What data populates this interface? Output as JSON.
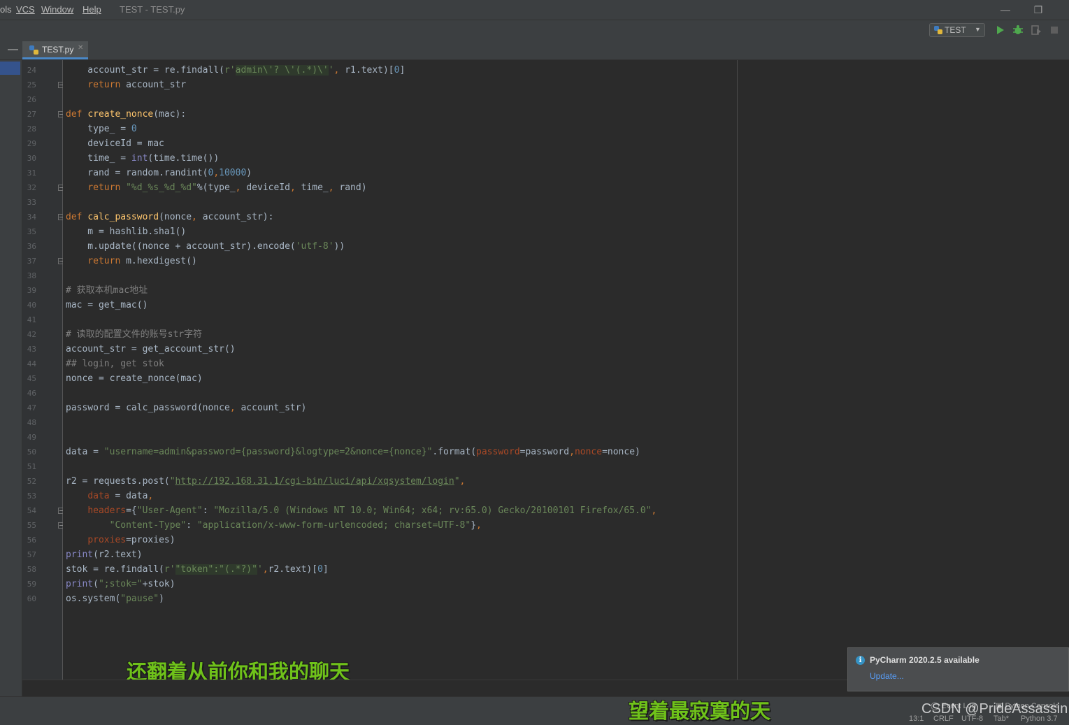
{
  "menu": {
    "items": [
      {
        "label": "ols"
      },
      {
        "label": "VCS"
      },
      {
        "label": "Window"
      },
      {
        "label": "Help"
      }
    ]
  },
  "window": {
    "title": "TEST - TEST.py"
  },
  "toolbar": {
    "run_config": "TEST"
  },
  "tabs": [
    {
      "label": "TEST.py"
    }
  ],
  "editor": {
    "lines": [
      {
        "n": "24",
        "fold": false,
        "html": "    account_str = re.findall(<span class=\"str\">r'</span><span class=\"regex\">admin\\'? \\'(.*)\\'</span><span class=\"str\">'</span><span class=\"kw\">, </span>r1.text)[<span class=\"num\">0</span>]"
      },
      {
        "n": "25",
        "fold": true,
        "html": "    <span class=\"kw\">return</span> account_str"
      },
      {
        "n": "26",
        "fold": false,
        "html": ""
      },
      {
        "n": "27",
        "fold": true,
        "html": "<span class=\"kw\">def</span> <span class=\"fn\">create_nonce</span>(mac):"
      },
      {
        "n": "28",
        "fold": false,
        "html": "    type_ = <span class=\"num\">0</span>"
      },
      {
        "n": "29",
        "fold": false,
        "html": "    deviceId = mac"
      },
      {
        "n": "30",
        "fold": false,
        "html": "    time_ = <span class=\"bi\">int</span>(time.time())"
      },
      {
        "n": "31",
        "fold": false,
        "html": "    rand = random.randint(<span class=\"num\">0</span><span class=\"kw\">,</span><span class=\"num\">10000</span>)"
      },
      {
        "n": "32",
        "fold": true,
        "html": "    <span class=\"kw\">return</span> <span class=\"str\">\"%d_%s_%d_%d\"</span>%(type_<span class=\"kw\">, </span>deviceId<span class=\"kw\">, </span>time_<span class=\"kw\">, </span>rand)"
      },
      {
        "n": "33",
        "fold": false,
        "html": ""
      },
      {
        "n": "34",
        "fold": true,
        "html": "<span class=\"kw\">def</span> <span class=\"fn\">calc_password</span>(nonce<span class=\"kw\">, </span>account_str):"
      },
      {
        "n": "35",
        "fold": false,
        "html": "    m = hashlib.sha1()"
      },
      {
        "n": "36",
        "fold": false,
        "html": "    m.update((nonce + account_str).encode(<span class=\"str\">'utf-8'</span>))"
      },
      {
        "n": "37",
        "fold": true,
        "html": "    <span class=\"kw\">return</span> m.hexdigest()"
      },
      {
        "n": "38",
        "fold": false,
        "html": ""
      },
      {
        "n": "39",
        "fold": false,
        "html": "<span class=\"cmt\"># 获取本机mac地址</span>"
      },
      {
        "n": "40",
        "fold": false,
        "html": "mac = get_mac()"
      },
      {
        "n": "41",
        "fold": false,
        "html": ""
      },
      {
        "n": "42",
        "fold": false,
        "html": "<span class=\"cmt\"># 读取的配置文件的账号str字符</span>"
      },
      {
        "n": "43",
        "fold": false,
        "html": "account_str = get_account_str()"
      },
      {
        "n": "44",
        "fold": false,
        "html": "<span class=\"cmt\">## login, get stok</span>"
      },
      {
        "n": "45",
        "fold": false,
        "html": "nonce = create_nonce(mac)"
      },
      {
        "n": "46",
        "fold": false,
        "html": ""
      },
      {
        "n": "47",
        "fold": false,
        "html": "password = calc_password(nonce<span class=\"kw\">, </span>account_str)"
      },
      {
        "n": "48",
        "fold": false,
        "html": ""
      },
      {
        "n": "49",
        "fold": false,
        "html": ""
      },
      {
        "n": "50",
        "fold": false,
        "html": "data = <span class=\"str\">\"username=admin&amp;password={password}&amp;logtype=2&amp;nonce={nonce}\"</span>.format(<span class=\"kwarg\">password</span>=password<span class=\"kw\">,</span><span class=\"kwarg\">nonce</span>=nonce)"
      },
      {
        "n": "51",
        "fold": false,
        "html": ""
      },
      {
        "n": "52",
        "fold": false,
        "html": "r2 = requests.post(<span class=\"str\">\"</span><span class=\"link\">http://192.168.31.1/cgi-bin/luci/api/xqsystem/login</span><span class=\"str\">\"</span><span class=\"kw\">,</span>"
      },
      {
        "n": "53",
        "fold": false,
        "html": "    <span class=\"kwarg\">data</span> = data<span class=\"kw\">,</span>"
      },
      {
        "n": "54",
        "fold": true,
        "html": "    <span class=\"kwarg\">headers</span>={<span class=\"str\">\"User-Agent\"</span>: <span class=\"str\">\"Mozilla/5.0 (Windows NT 10.0; Win64; x64; rv:65.0) Gecko/20100101 Firefox/65.0\"</span><span class=\"kw\">,</span>"
      },
      {
        "n": "55",
        "fold": true,
        "html": "        <span class=\"str\">\"Content-Type\"</span>: <span class=\"str\">\"application/x-www-form-urlencoded; charset=UTF-8\"</span>}<span class=\"kw\">,</span>"
      },
      {
        "n": "56",
        "fold": false,
        "html": "    <span class=\"kwarg\">proxies</span>=proxies)"
      },
      {
        "n": "57",
        "fold": false,
        "html": "<span class=\"bi\">print</span>(r2.text)"
      },
      {
        "n": "58",
        "fold": false,
        "html": "stok = re.findall(<span class=\"str\">r'</span><span class=\"regex\">\"token\":\"(.*?)\"</span><span class=\"str\">'</span><span class=\"kw\">,</span>r2.text)[<span class=\"num\">0</span>]"
      },
      {
        "n": "59",
        "fold": false,
        "html": "<span class=\"bi\">print</span>(<span class=\"str\">\";stok=\"</span>+stok)"
      },
      {
        "n": "60",
        "fold": false,
        "html": "os.system(<span class=\"str\">\"pause\"</span>)"
      }
    ]
  },
  "notification": {
    "title": "PyCharm 2020.2.5 available",
    "link": "Update..."
  },
  "statusbar": {
    "event_log": "Event Log",
    "python_console": "Python Console",
    "position": "13:1",
    "line_sep": "CRLF",
    "encoding": "UTF-8",
    "indent": "Tab*",
    "interpreter": "Python 3.7"
  },
  "overlay": {
    "subtitle_1": "还翻着从前你和我的聊天",
    "subtitle_2": "望着最寂寞的天",
    "watermark": "CSDN @PrideAssassin"
  },
  "colors": {
    "keyword": "#cc7832",
    "function": "#ffc66d",
    "number": "#6897bb",
    "string": "#6a8759",
    "comment": "#808080",
    "builtin": "#8888c6",
    "kwarg": "#aa4926",
    "subtitle": "#6fc21a",
    "link": "#589df6"
  }
}
